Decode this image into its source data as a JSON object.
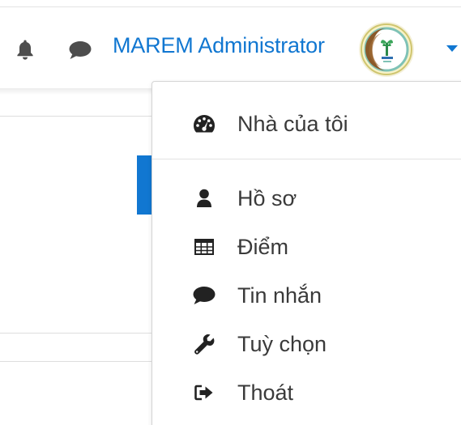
{
  "header": {
    "user_name": "MAREM Administrator",
    "notification_icon": "bell-icon",
    "message_icon": "chat-bubble-icon",
    "avatar_icon": "organization-logo-avatar",
    "menu_toggle_icon": "caret-down-icon"
  },
  "colors": {
    "accent": "#1177d1",
    "icon_gray": "#4d4d4d",
    "menu_text": "#3a3a3a",
    "menu_icon": "#222222"
  },
  "user_menu": {
    "items": [
      {
        "label": "Nhà của tôi",
        "icon": "dashboard-gauge-icon"
      },
      {
        "label": "Hồ sơ",
        "icon": "user-icon"
      },
      {
        "label": "Điểm",
        "icon": "table-grid-icon"
      },
      {
        "label": "Tin nhắn",
        "icon": "chat-bubble-icon"
      },
      {
        "label": "Tuỳ chọn",
        "icon": "wrench-icon"
      },
      {
        "label": "Thoát",
        "icon": "sign-out-icon"
      }
    ]
  }
}
